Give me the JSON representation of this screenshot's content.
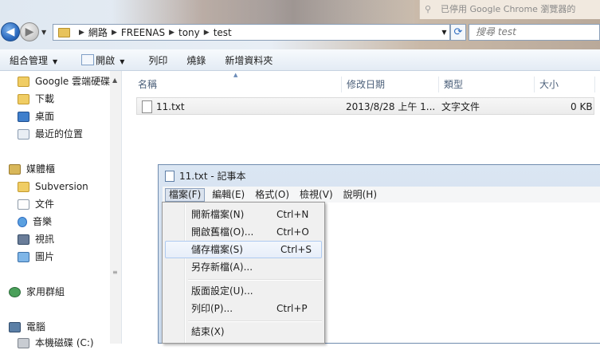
{
  "explorer": {
    "chrome_tip": "已停用 Google Chrome 瀏覽器的",
    "address": {
      "breadcrumbs": [
        "網路",
        "FREENAS",
        "tony",
        "test"
      ]
    },
    "search_placeholder": "搜尋 test",
    "commands": [
      {
        "label": "組合管理",
        "dropdown": true
      },
      {
        "label": "開啟",
        "dropdown": true,
        "icon": "open-icon"
      },
      {
        "label": "列印"
      },
      {
        "label": "燒錄"
      },
      {
        "label": "新增資料夾"
      }
    ],
    "sidebar": {
      "items": [
        {
          "label": "Google 雲端硬碟",
          "icon": "folder-icon"
        },
        {
          "label": "下載",
          "icon": "folder-icon"
        },
        {
          "label": "桌面",
          "icon": "desktop-icon"
        },
        {
          "label": "最近的位置",
          "icon": "recent-places-icon"
        },
        {
          "label": "媒體櫃",
          "icon": "library-icon"
        },
        {
          "label": "Subversion",
          "icon": "folder-icon"
        },
        {
          "label": "文件",
          "icon": "documents-icon"
        },
        {
          "label": "音樂",
          "icon": "music-icon"
        },
        {
          "label": "視訊",
          "icon": "video-icon"
        },
        {
          "label": "圖片",
          "icon": "pictures-icon"
        },
        {
          "label": "家用群組",
          "icon": "homegroup-icon"
        },
        {
          "label": "電腦",
          "icon": "computer-icon"
        },
        {
          "label": "本機磁碟 (C:)",
          "icon": "drive-icon"
        }
      ]
    },
    "columns": [
      "名稱",
      "修改日期",
      "類型",
      "大小"
    ],
    "files": [
      {
        "name": "11.txt",
        "modified": "2013/8/28 上午 1...",
        "type": "文字文件",
        "size": "0 KB"
      }
    ]
  },
  "notepad": {
    "title": "11.txt - 記事本",
    "menus": [
      "檔案(F)",
      "編輯(E)",
      "格式(O)",
      "檢視(V)",
      "說明(H)"
    ],
    "file_menu": {
      "items": [
        {
          "label": "開新檔案(N)",
          "shortcut": "Ctrl+N"
        },
        {
          "label": "開啟舊檔(O)...",
          "shortcut": "Ctrl+O"
        },
        {
          "label": "儲存檔案(S)",
          "shortcut": "Ctrl+S",
          "highlighted": true
        },
        {
          "label": "另存新檔(A)...",
          "shortcut": ""
        },
        {
          "label": "版面設定(U)...",
          "shortcut": ""
        },
        {
          "label": "列印(P)...",
          "shortcut": "Ctrl+P"
        },
        {
          "label": "結束(X)",
          "shortcut": ""
        }
      ]
    }
  }
}
